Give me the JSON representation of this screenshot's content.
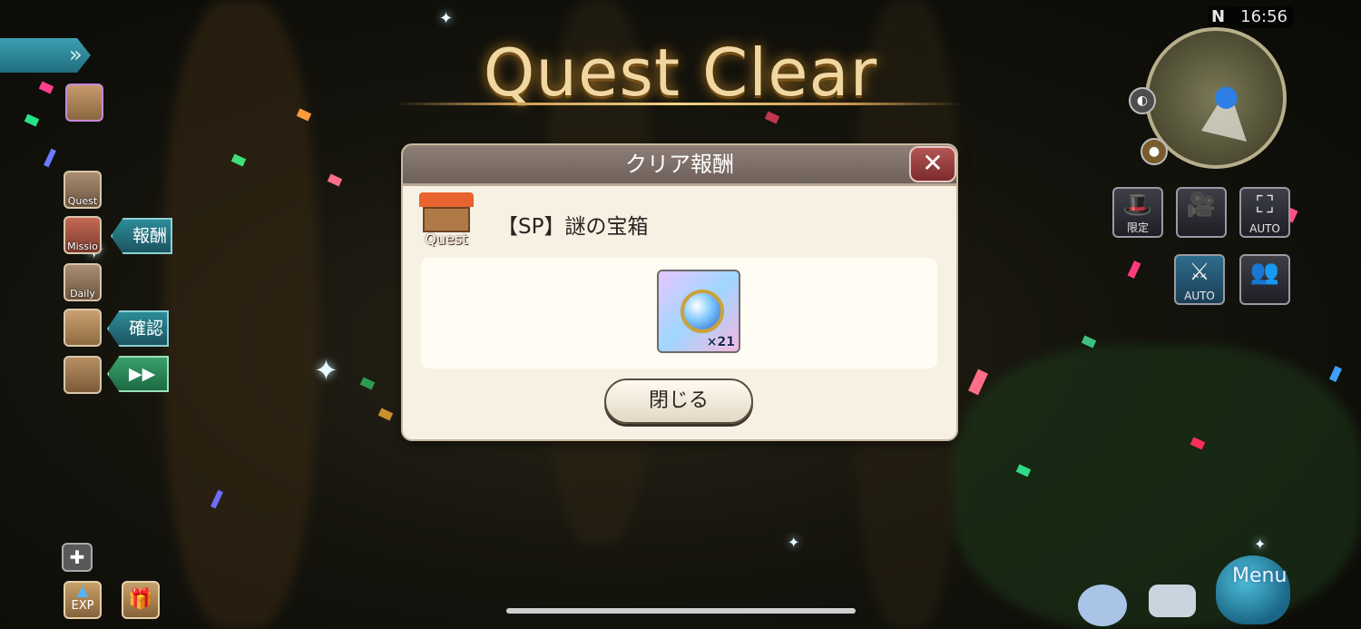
{
  "title": "Quest Clear",
  "dialog": {
    "header": "クリア報酬",
    "quest_label": "Quest",
    "reward_name": "【SP】謎の宝箱",
    "item": {
      "icon": "crystal-orb-icon",
      "count": "×21"
    },
    "close_button": "閉じる"
  },
  "left_hud": {
    "quest_label": "Quest",
    "mission_label": "Missio",
    "daily_label": "Daily",
    "reward_tag": "報酬",
    "confirm_tag": "確認",
    "skip_tag": "▶▶",
    "exp_label": "EXP"
  },
  "right_hud": {
    "clock": "16:56",
    "compass": "N",
    "limited_label": "限定",
    "auto_label": "AUTO",
    "auto2_label": "AUTO"
  },
  "menu_label": "Menu",
  "colors": {
    "accent_gold": "#f0d7a1",
    "dialog_bg": "#f6f1e3",
    "close_red": "#9b3b3c"
  }
}
